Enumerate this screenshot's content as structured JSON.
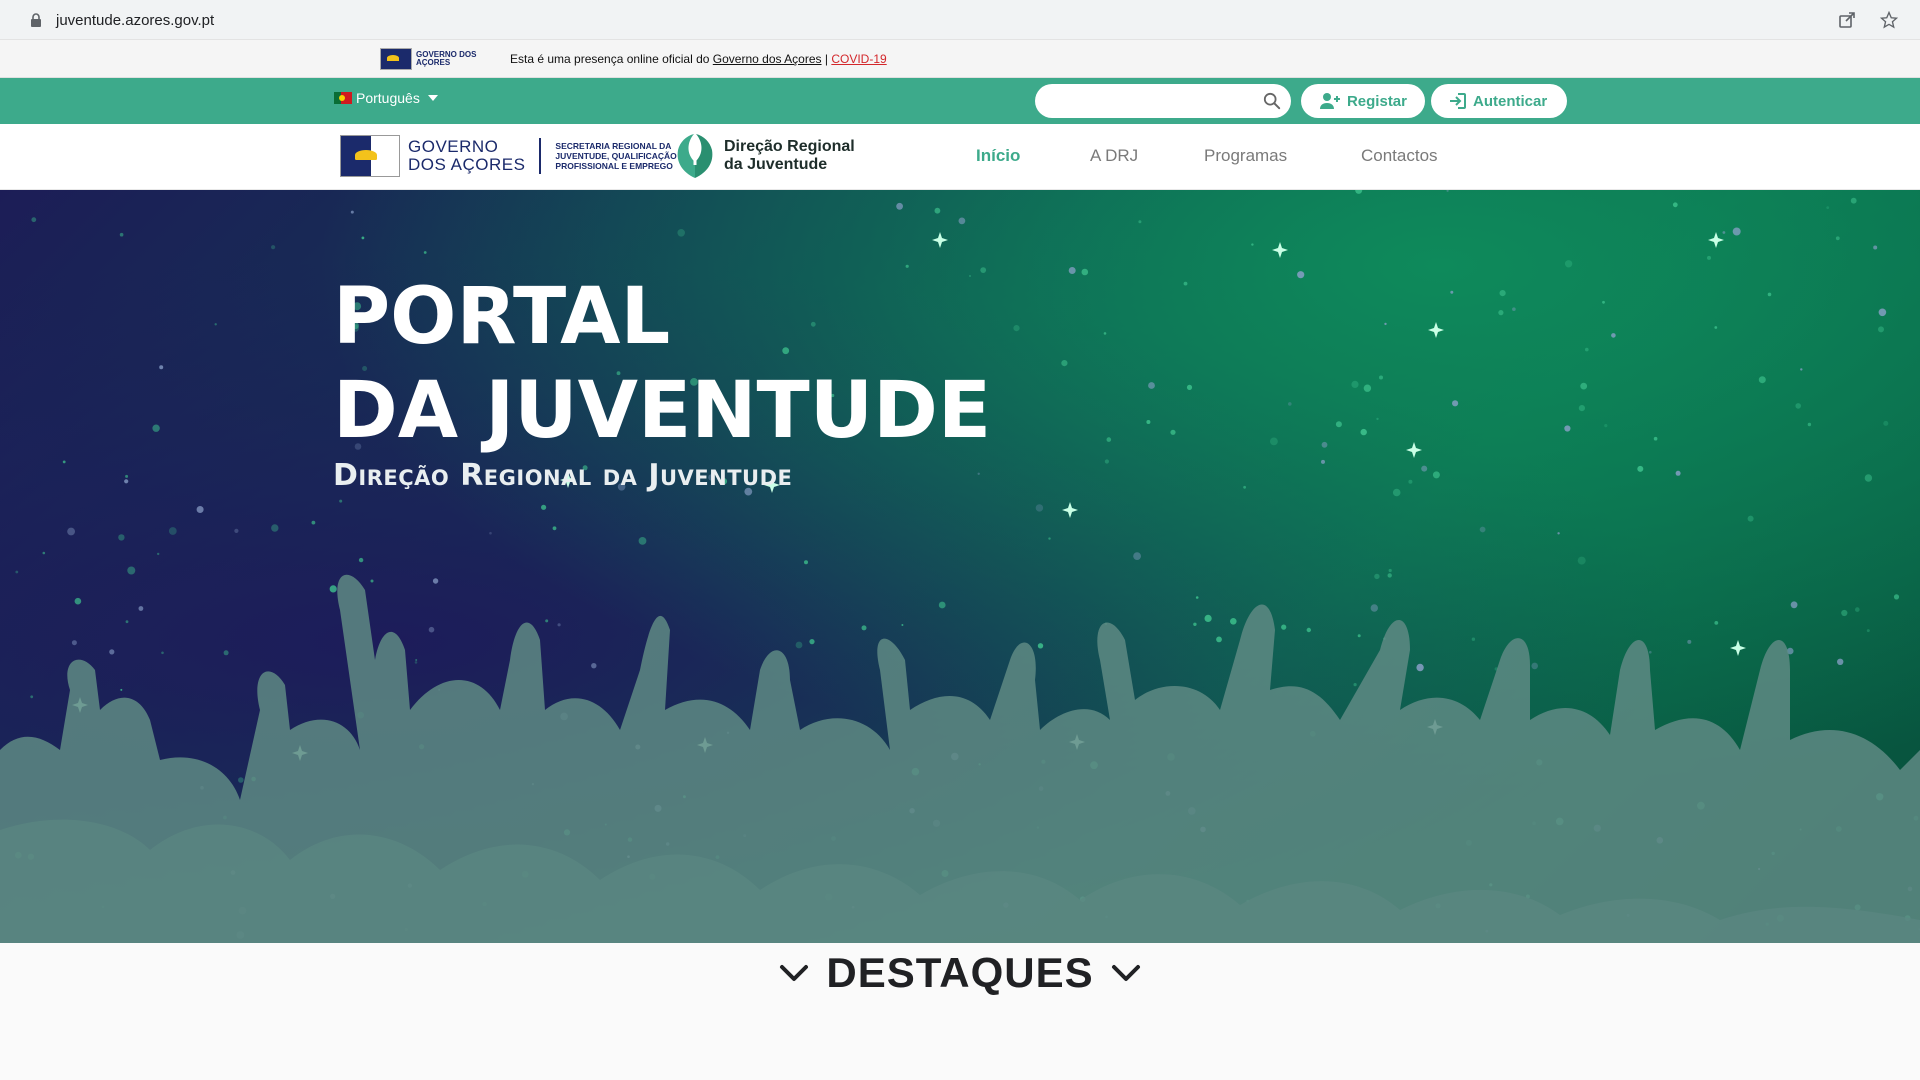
{
  "browser": {
    "url": "juventude.azores.gov.pt"
  },
  "official": {
    "logo_text": "GOVERNO DOS AÇORES",
    "prefix": "Esta é uma presença online oficial do",
    "gov_link": "Governo dos Açores",
    "separator": "|",
    "covid_link": "COVID-19"
  },
  "topbar": {
    "language": "Português",
    "search_placeholder": "",
    "register_label": "Registar",
    "login_label": "Autenticar"
  },
  "header": {
    "gov_line1": "GOVERNO",
    "gov_line2": "DOS AÇORES",
    "secretaria": "SECRETARIA REGIONAL DA JUVENTUDE, QUALIFICAÇÃO PROFISSIONAL E EMPREGO",
    "drj_line1": "Direção Regional",
    "drj_line2": "da Juventude",
    "nav": [
      "Início",
      "A DRJ",
      "Programas",
      "Contactos"
    ]
  },
  "hero": {
    "title_line1": "PORTAL",
    "title_line2": "DA JUVENTUDE",
    "subtitle": "Direção Regional da Juventude"
  },
  "section": {
    "destaques": "DESTAQUES"
  },
  "colors": {
    "brand_green": "#3daa8b",
    "navy": "#1b2a6b",
    "covid_red": "#d3272b"
  },
  "icons": [
    "lock-icon",
    "share-icon",
    "star-icon",
    "portugal-flag-icon",
    "caret-down-icon",
    "search-icon",
    "add-user-icon",
    "login-icon",
    "chevron-down-icon"
  ]
}
